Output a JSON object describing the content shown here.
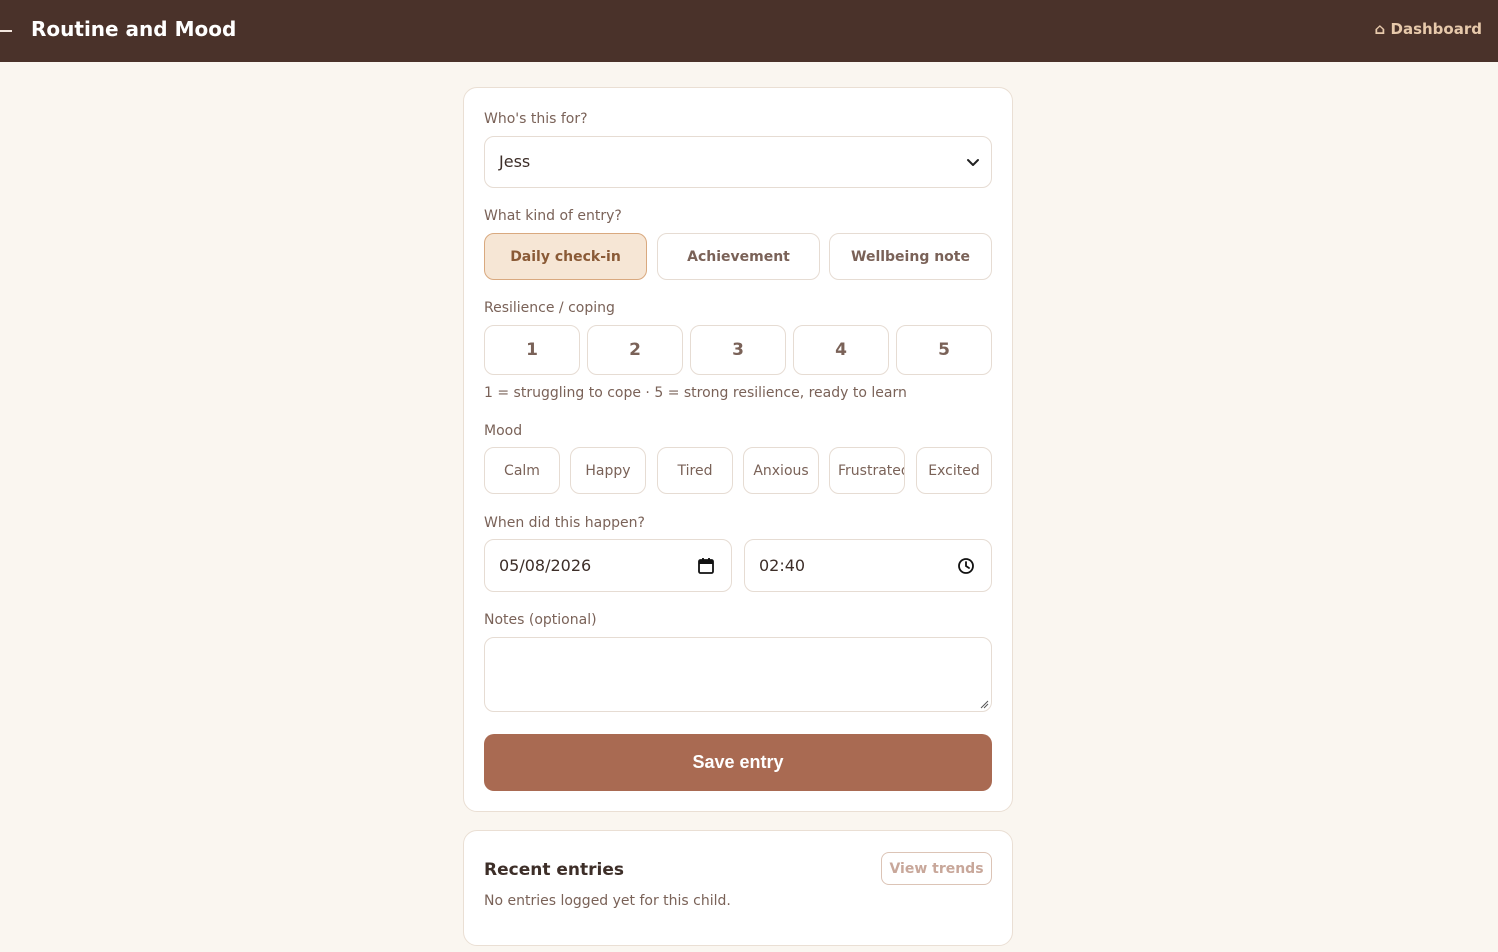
{
  "header": {
    "title": "Routine and Mood",
    "dashboard_link": "⌂ Dashboard"
  },
  "form": {
    "who_label": "Who's this for?",
    "who_value": "Jess",
    "entry_type_label": "What kind of entry?",
    "entry_types": [
      {
        "label": "Daily check-in",
        "selected": true
      },
      {
        "label": "Achievement",
        "selected": false
      },
      {
        "label": "Wellbeing note",
        "selected": false
      }
    ],
    "resilience_label": "Resilience / coping",
    "resilience_options": [
      "1",
      "2",
      "3",
      "4",
      "5"
    ],
    "resilience_hint": "1 = struggling to cope  ·  5 = strong resilience, ready to learn",
    "mood_label": "Mood",
    "moods": [
      "Calm",
      "Happy",
      "Tired",
      "Anxious",
      "Frustrated",
      "Excited"
    ],
    "when_label": "When did this happen?",
    "date_value": "05/08/2026",
    "time_value": "02:40",
    "notes_label": "Notes (optional)",
    "notes_value": "",
    "save_label": "Save entry"
  },
  "recent": {
    "title": "Recent entries",
    "view_trends_label": "View trends",
    "empty_text": "No entries logged yet for this child."
  },
  "colors": {
    "header_bg": "#4a322a",
    "page_bg": "#faf6f0",
    "accent": "#a96a52",
    "selected_bg": "#f6e6d5",
    "selected_border": "#d9a97f"
  },
  "icons": [
    "menu-icon",
    "home-icon",
    "chevron-down-icon",
    "calendar-icon",
    "clock-icon",
    "resize-grip-icon"
  ]
}
